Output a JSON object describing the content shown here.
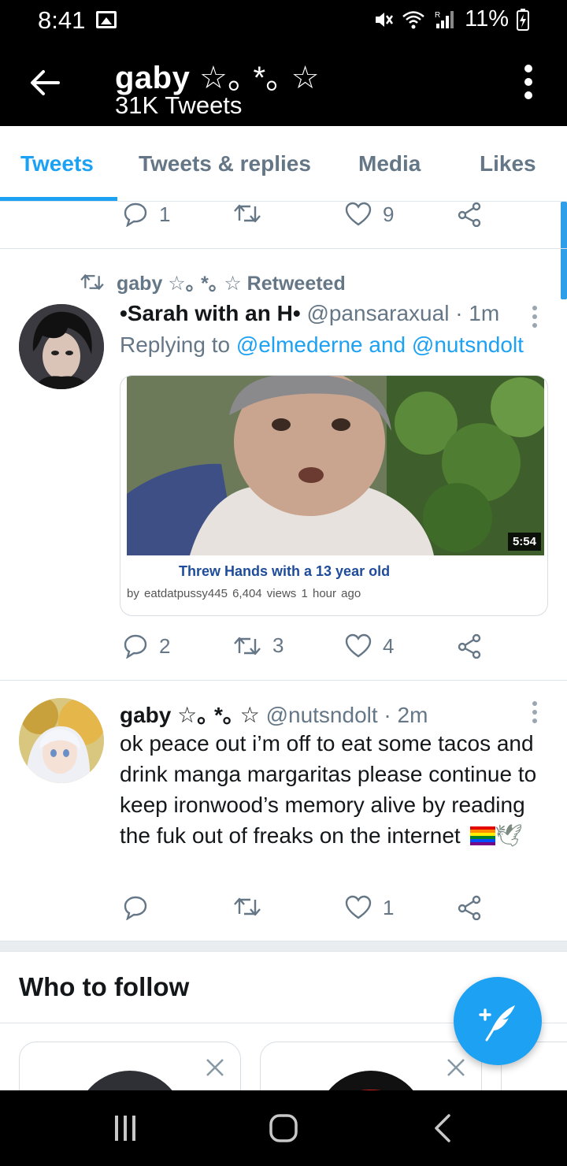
{
  "status_bar": {
    "time": "8:41",
    "battery": "11%"
  },
  "header": {
    "profile_name": "gaby",
    "name_stars": "☆｡ *｡ ☆",
    "tweet_count": "31K Tweets"
  },
  "tabs": [
    {
      "label": "Tweets",
      "active": true
    },
    {
      "label": "Tweets & replies",
      "active": false
    },
    {
      "label": "Media",
      "active": false
    },
    {
      "label": "Likes",
      "active": false
    }
  ],
  "top_tweet_actions": {
    "replies": "1",
    "retweets": "",
    "likes": "9"
  },
  "retweet_tweet": {
    "context": "gaby ☆｡ *｡ ☆ Retweeted",
    "author_name": "•Sarah with an H•",
    "author_handle": "@pansaraxual · 1m",
    "replying_prefix": "Replying to ",
    "replying_to_1": "@elmederne",
    "replying_and": " and ",
    "replying_to_2": "@nutsndolt",
    "video": {
      "duration": "5:54",
      "title": "Threw Hands with a 13 year old",
      "meta": "by eatdatpussy445 6,404 views 1 hour ago"
    },
    "actions": {
      "replies": "2",
      "retweets": "3",
      "likes": "4"
    }
  },
  "second_tweet": {
    "author_name": "gaby ☆｡ *｡ ☆",
    "author_handle": "@nutsndolt · 2m",
    "text": "ok peace out i’m off to eat some tacos and drink manga margaritas please continue to keep ironwood’s memory alive by reading the fuk out of freaks on the internet",
    "emoji_dove": "🕊",
    "actions": {
      "replies": "",
      "retweets": "",
      "likes": "1"
    }
  },
  "who_to_follow": {
    "title": "Who to follow"
  },
  "colors": {
    "accent": "#1da1f2",
    "text_secondary": "#657786",
    "bar_bg": "#000000"
  }
}
